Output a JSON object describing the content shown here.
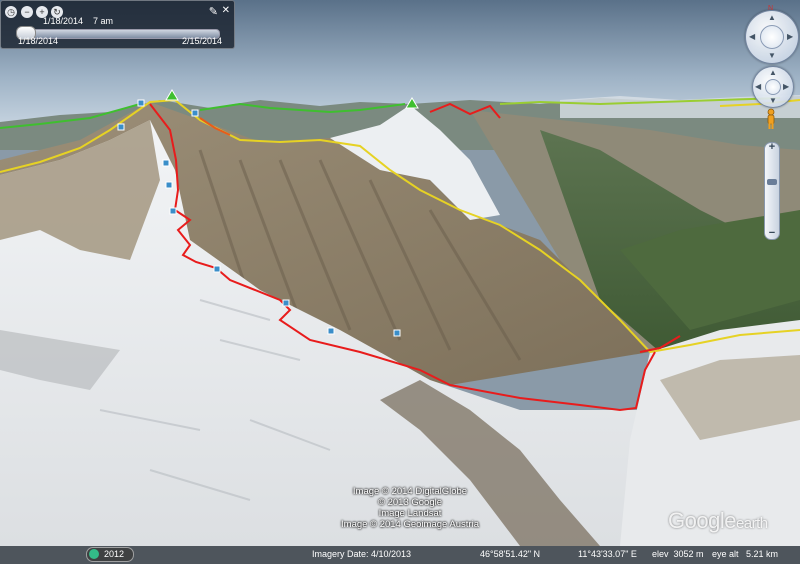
{
  "timeline": {
    "current_time": "1/18/2014    7 am",
    "start_date": "1/18/2014",
    "end_date": "2/15/2014",
    "icons": [
      "clock-icon",
      "zoom-out-icon",
      "zoom-in-icon",
      "refresh-icon"
    ]
  },
  "historical_imagery": {
    "year": "2012"
  },
  "credits": [
    "Image © 2014 DigitalGlobe",
    "© 2013 Google",
    "Image Landsat",
    "Image © 2014 Geoimage Austria"
  ],
  "logo": {
    "google": "Google",
    "earth": "earth"
  },
  "statusbar": {
    "imagery_date": "Imagery Date: 4/10/2013",
    "lat": "46°58'51.42\" N",
    "lon": "11°43'33.07\" E",
    "elev": "elev  3052 m",
    "eye_alt": "eye alt   5.21 km"
  },
  "colors": {
    "route": "#e81c1c",
    "ridge_line": "#e6d224",
    "track_green": "#3fbf2f"
  }
}
